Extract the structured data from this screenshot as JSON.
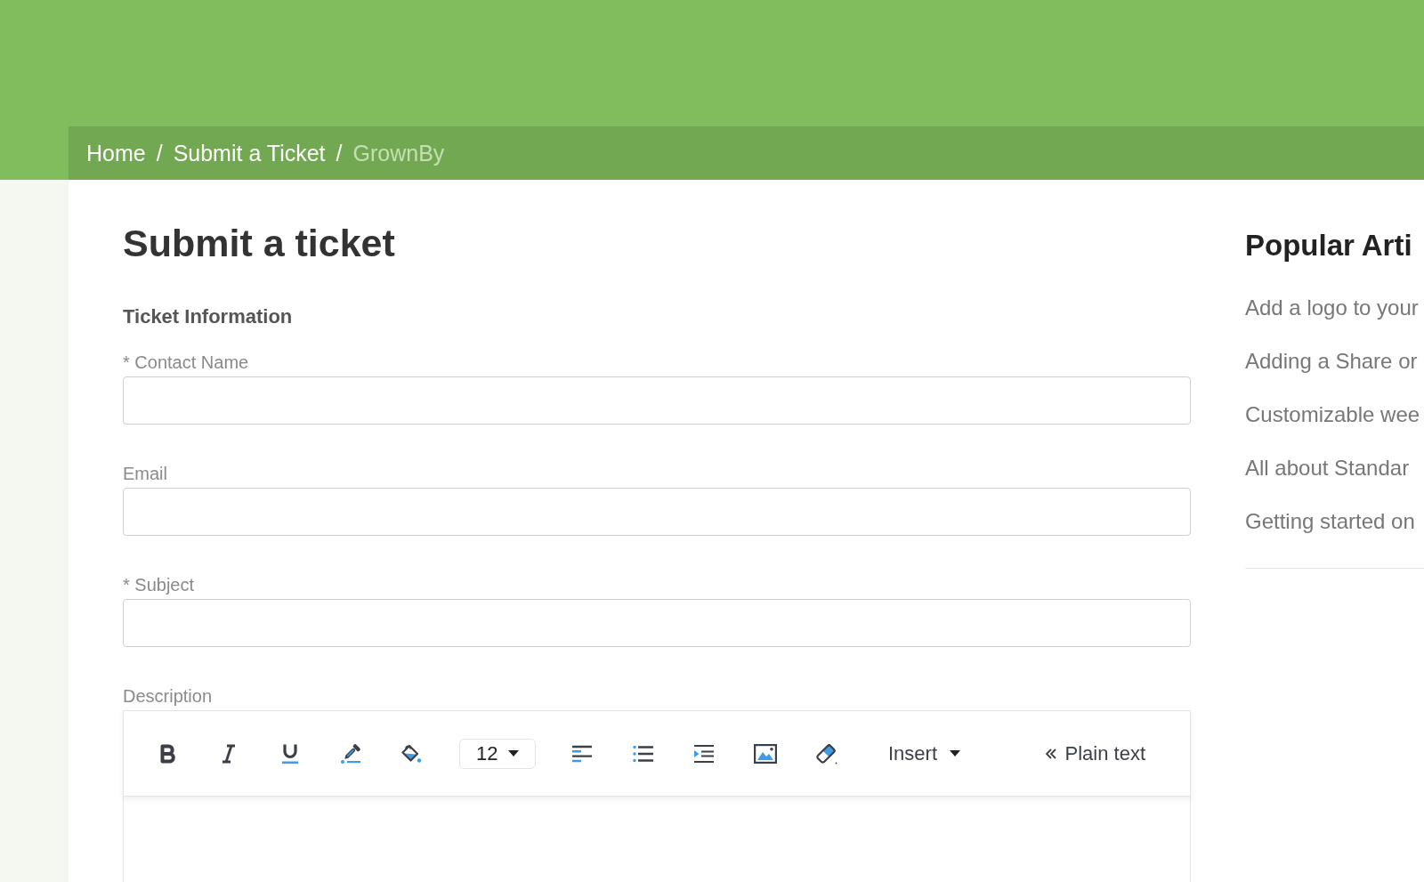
{
  "breadcrumb": [
    {
      "label": "Home",
      "current": false,
      "separator": "/"
    },
    {
      "label": "Submit a Ticket",
      "current": false,
      "separator": "/"
    },
    {
      "label": "GrownBy",
      "current": true
    }
  ],
  "page_title": "Submit a ticket",
  "form": {
    "section_title": "Ticket Information",
    "fields": [
      {
        "label": "* Contact Name",
        "kind": "text"
      },
      {
        "label": "Email",
        "kind": "text"
      },
      {
        "label": "* Subject",
        "kind": "text"
      },
      {
        "label": "Description",
        "kind": "rich_text",
        "toolbar": [
          {
            "kind": "bold"
          },
          {
            "kind": "italic"
          },
          {
            "kind": "underline"
          },
          {
            "kind": "text_color"
          },
          {
            "kind": "fill_color"
          },
          {
            "kind": "font_size",
            "value": "12"
          },
          {
            "kind": "align_left"
          },
          {
            "kind": "bullet_list"
          },
          {
            "kind": "indent"
          },
          {
            "kind": "image"
          },
          {
            "kind": "clear_format"
          },
          {
            "kind": "insert",
            "label": "Insert"
          },
          {
            "kind": "plain_text",
            "label": "Plain text"
          }
        ]
      }
    ]
  },
  "sidebar": {
    "title": "Popular Arti",
    "articles": [
      "Add a logo to your",
      "Adding a Share or",
      "Customizable wee",
      "All about Standar",
      "Getting started on"
    ]
  }
}
